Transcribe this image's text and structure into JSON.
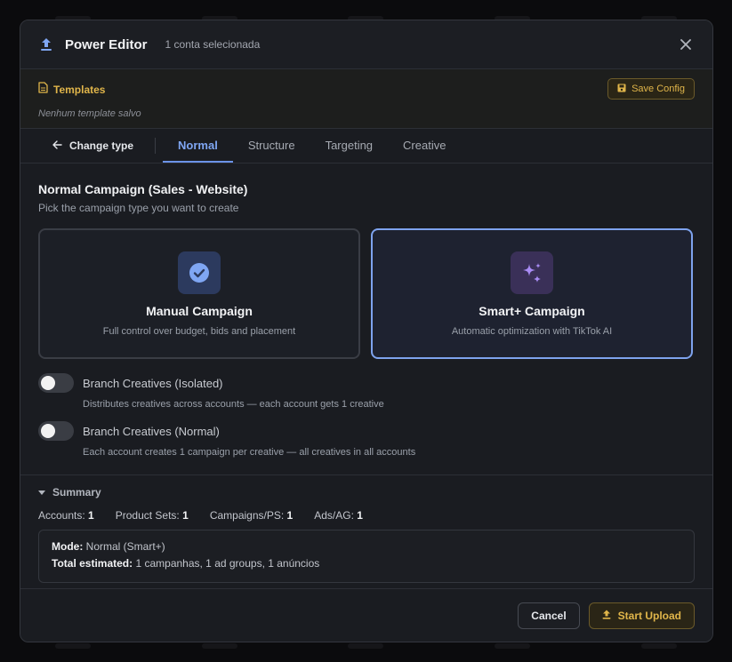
{
  "header": {
    "title": "Power Editor",
    "subtitle": "1 conta selecionada"
  },
  "templates": {
    "title": "Templates",
    "empty_text": "Nenhum template salvo",
    "save_label": "Save Config"
  },
  "tabs": {
    "change_type": "Change type",
    "items": [
      {
        "label": "Normal",
        "active": true
      },
      {
        "label": "Structure",
        "active": false
      },
      {
        "label": "Targeting",
        "active": false
      },
      {
        "label": "Creative",
        "active": false
      }
    ]
  },
  "content": {
    "title": "Normal Campaign (Sales - Website)",
    "subtitle": "Pick the campaign type you want to create",
    "cards": [
      {
        "title": "Manual Campaign",
        "desc": "Full control over budget, bids and placement",
        "icon": "check-circle-icon",
        "selected": false
      },
      {
        "title": "Smart+ Campaign",
        "desc": "Automatic optimization with TikTok AI",
        "icon": "sparkles-icon",
        "selected": true
      }
    ],
    "toggles": [
      {
        "label": "Branch Creatives (Isolated)",
        "desc": "Distributes creatives across accounts — each account gets 1 creative",
        "on": false
      },
      {
        "label": "Branch Creatives (Normal)",
        "desc": "Each account creates 1 campaign per creative — all creatives in all accounts",
        "on": false
      }
    ]
  },
  "summary": {
    "title": "Summary",
    "counts": [
      {
        "label": "Accounts:",
        "value": "1"
      },
      {
        "label": "Product Sets:",
        "value": "1"
      },
      {
        "label": "Campaigns/PS:",
        "value": "1"
      },
      {
        "label": "Ads/AG:",
        "value": "1"
      }
    ],
    "mode_label": "Mode:",
    "mode_value": "Normal (Smart+)",
    "total_label": "Total estimated:",
    "total_value": "1 campanhas, 1 ad groups, 1 anúncios"
  },
  "footer": {
    "cancel_label": "Cancel",
    "start_label": "Start Upload"
  },
  "colors": {
    "accent_blue": "#7fa6f3",
    "accent_gold": "#e0b54a",
    "purple": "#a98cf5"
  }
}
